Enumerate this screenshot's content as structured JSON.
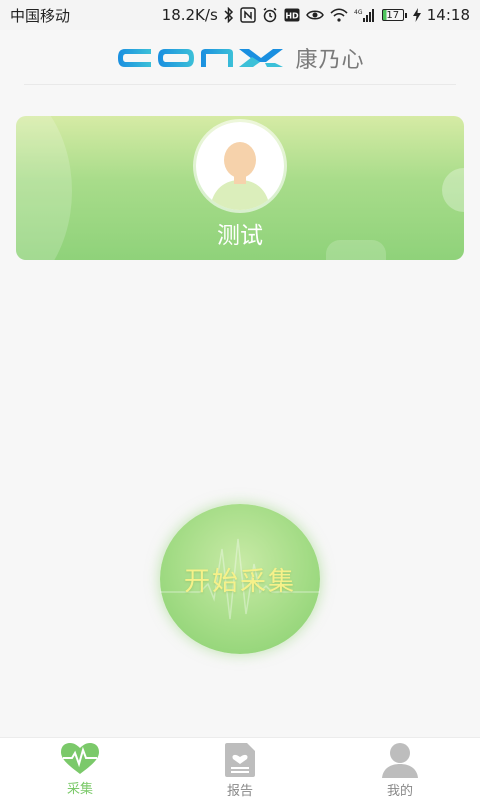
{
  "status_bar": {
    "carrier": "中国移动",
    "speed": "18.2K/s",
    "battery": "17",
    "time": "14:18",
    "net_badge": "4G"
  },
  "header": {
    "brand_latin": "CONX",
    "brand_cn": "康乃心",
    "colors": {
      "logo": "#1a8fe0",
      "logo_alt": "#3cc0d8"
    }
  },
  "profile": {
    "name": "测试",
    "colors": {
      "card_top": "#d6eba5",
      "card_bottom": "#8fd27a"
    }
  },
  "start": {
    "label": "开始采集",
    "colors": {
      "fill": "#a4dc86",
      "text": "#f6f18a"
    }
  },
  "tabs": [
    {
      "label": "采集",
      "icon": "heart-pulse-icon",
      "active": true
    },
    {
      "label": "报告",
      "icon": "report-document-icon",
      "active": false
    },
    {
      "label": "我的",
      "icon": "user-profile-icon",
      "active": false
    }
  ],
  "accent": "#7bc96a"
}
